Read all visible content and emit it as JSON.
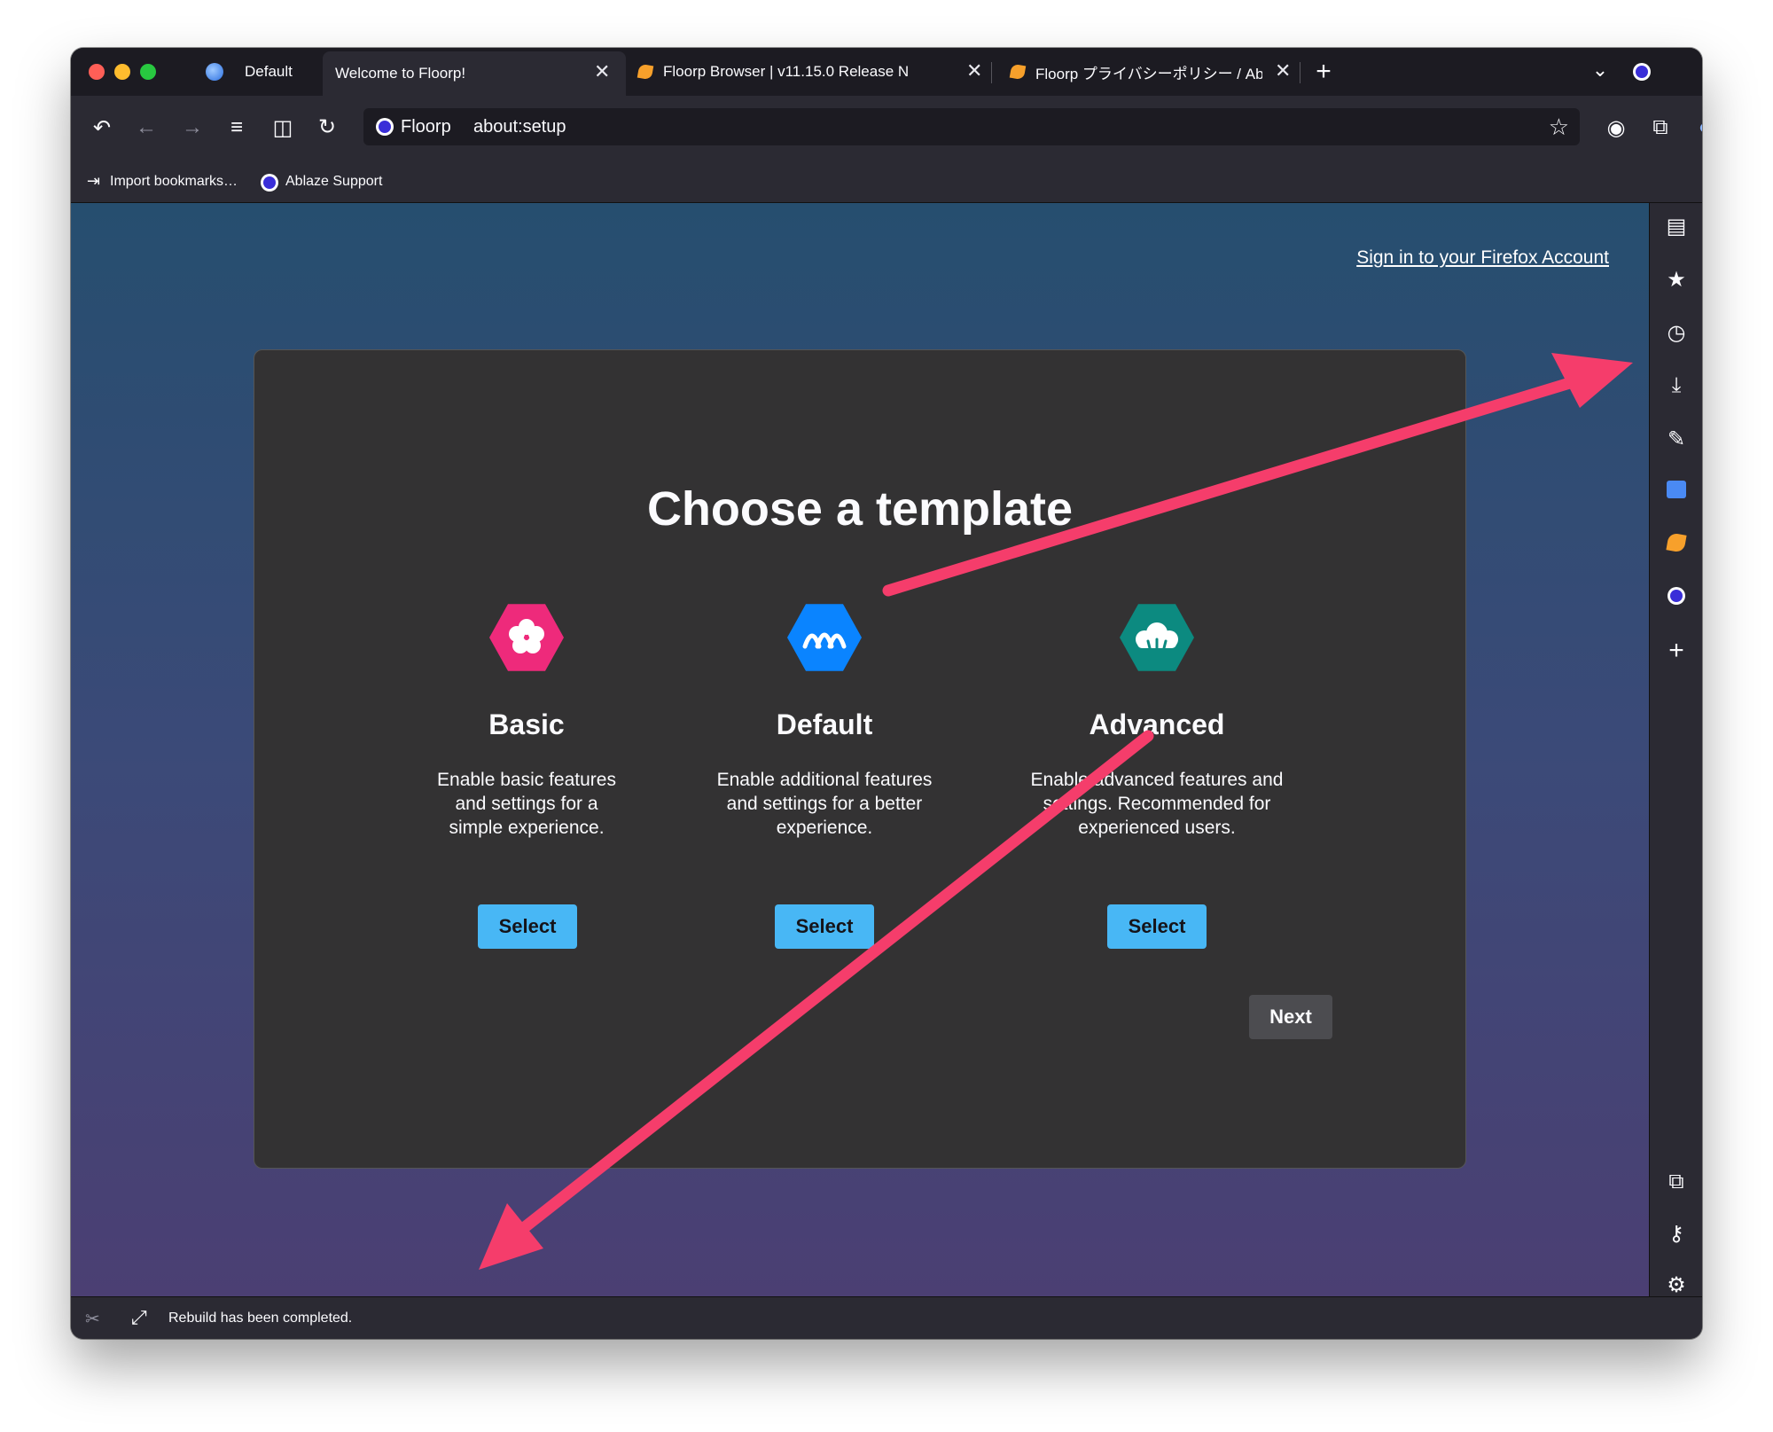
{
  "tabs": [
    {
      "label": "Default",
      "icon": "profile-globe-icon"
    },
    {
      "label": "Welcome to Floorp!",
      "active": true
    },
    {
      "label": "Floorp Browser | v11.15.0 Release N",
      "icon": "floorp-leaf-icon"
    },
    {
      "label": "Floorp プライバシーポリシー / Abla",
      "icon": "floorp-leaf-icon"
    }
  ],
  "urlbar": {
    "identity": "Floorp",
    "url": "about:setup"
  },
  "bookmarks": [
    {
      "label": "Import bookmarks…",
      "icon": "import-icon"
    },
    {
      "label": "Ablaze Support",
      "icon": "floorp-logo-icon"
    }
  ],
  "page": {
    "signin_link": "Sign in to your Firefox Account",
    "title": "Choose a template",
    "templates": [
      {
        "name": "Basic",
        "desc_lines": [
          "Enable basic features",
          "and settings for a",
          "simple experience."
        ],
        "button": "Select",
        "color": "#ee2a7b",
        "icon": "plum-blossom-icon"
      },
      {
        "name": "Default",
        "desc_lines": [
          "Enable additional features",
          "and settings for a better",
          "experience."
        ],
        "button": "Select",
        "color": "#0a84ff",
        "icon": "pine-icon"
      },
      {
        "name": "Advanced",
        "desc_lines": [
          "Enable advanced features and",
          "settings. Recommended for",
          "experienced users."
        ],
        "button": "Select",
        "color": "#0c8a80",
        "icon": "bonsai-icon"
      }
    ],
    "next_button": "Next"
  },
  "statusbar": {
    "message": "Rebuild has been completed."
  },
  "colors": {
    "accent": "#48b7f5",
    "annotation_arrow": "#f53d6b"
  }
}
